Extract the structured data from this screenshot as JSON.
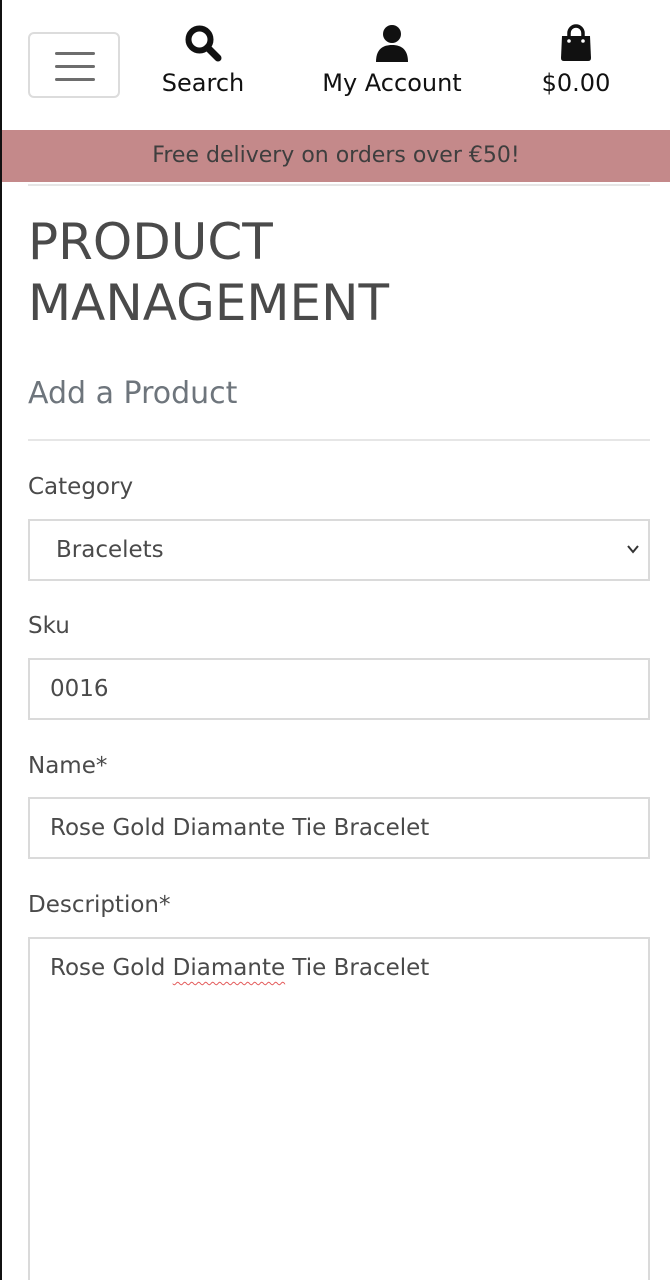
{
  "header": {
    "search_label": "Search",
    "account_label": "My Account",
    "bag_total": "$0.00",
    "icons": {
      "menu": "hamburger-icon",
      "search": "search-icon",
      "account": "user-icon",
      "bag": "shopping-bag-icon"
    }
  },
  "banner": {
    "text": "Free delivery on orders over €50!",
    "color": "#c4898a"
  },
  "page": {
    "title": "PRODUCT MANAGEMENT",
    "subtitle": "Add a Product"
  },
  "form": {
    "category": {
      "label": "Category",
      "value": "Bracelets"
    },
    "sku": {
      "label": "Sku",
      "value": "0016"
    },
    "name": {
      "label": "Name*",
      "value": "Rose Gold Diamante Tie Bracelet"
    },
    "description": {
      "label": "Description*",
      "value_before": "Rose Gold ",
      "value_misspelled": "Diamante",
      "value_after": " Tie Bracelet"
    }
  }
}
